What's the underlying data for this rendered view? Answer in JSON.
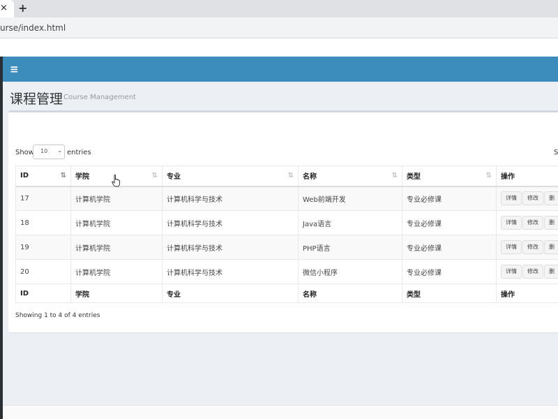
{
  "browser": {
    "close_glyph": "×",
    "new_tab_glyph": "+",
    "url": "urse/index.html"
  },
  "navbar": {
    "menu_glyph": "≡"
  },
  "header": {
    "title": "课程管理",
    "subtitle": "Course Management"
  },
  "length_menu": {
    "show_label": "Show",
    "value": "10",
    "entries_label": "entries"
  },
  "search": {
    "label_fragment": "S"
  },
  "table": {
    "columns": [
      {
        "label": "ID",
        "sort_icon": "sort-asc-icon"
      },
      {
        "label": "学院",
        "sort_icon": "sort-icon"
      },
      {
        "label": "专业",
        "sort_icon": "sort-icon"
      },
      {
        "label": "名称",
        "sort_icon": "sort-icon"
      },
      {
        "label": "类型",
        "sort_icon": "sort-icon"
      },
      {
        "label": "操作",
        "sort_icon": ""
      }
    ],
    "rows": [
      {
        "id": "17",
        "college": "计算机学院",
        "major": "计算机科学与技术",
        "name": "Web前端开发",
        "type": "专业必修课"
      },
      {
        "id": "18",
        "college": "计算机学院",
        "major": "计算机科学与技术",
        "name": "Java语言",
        "type": "专业必修课"
      },
      {
        "id": "19",
        "college": "计算机学院",
        "major": "计算机科学与技术",
        "name": "PHP语言",
        "type": "专业必修课"
      },
      {
        "id": "20",
        "college": "计算机学院",
        "major": "计算机科学与技术",
        "name": "微信小程序",
        "type": "专业必修课"
      }
    ],
    "actions": {
      "detail": "详情",
      "edit": "修改",
      "delete": "删"
    }
  },
  "info": "Showing 1 to 4 of 4 entries",
  "colors": {
    "navbar": "#3c8dbc",
    "content_bg": "#ecf0f5",
    "box_bg": "#ffffff"
  }
}
